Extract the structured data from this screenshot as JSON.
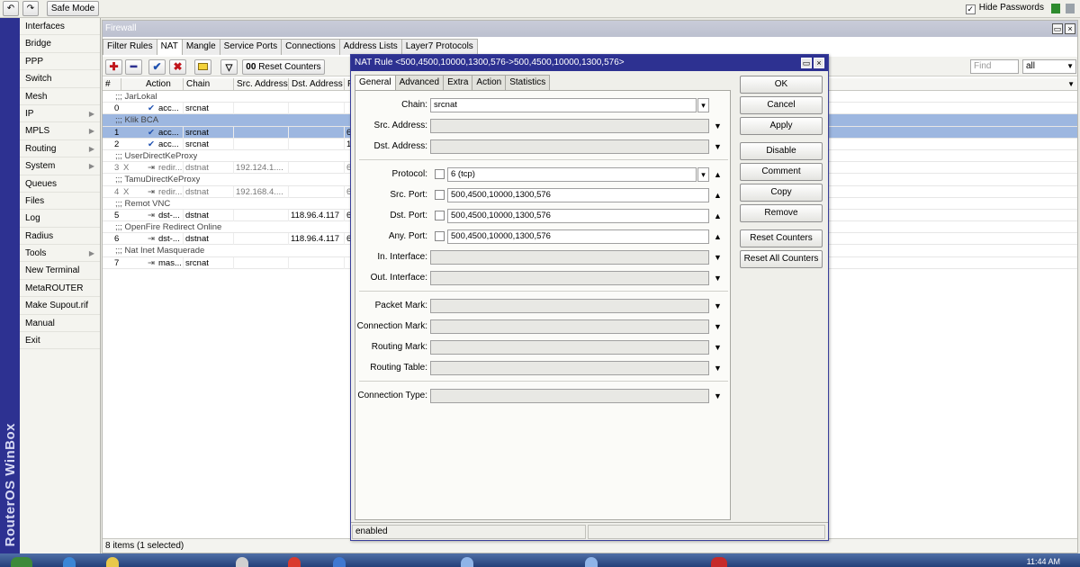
{
  "topbar": {
    "safe_mode_label": "Safe Mode",
    "hide_passwords_label": "Hide Passwords",
    "hide_passwords_checked": true
  },
  "sidebar": {
    "brand": "RouterOS WinBox",
    "items": [
      {
        "label": "Interfaces",
        "submenu": false
      },
      {
        "label": "Bridge",
        "submenu": false
      },
      {
        "label": "PPP",
        "submenu": false
      },
      {
        "label": "Switch",
        "submenu": false
      },
      {
        "label": "Mesh",
        "submenu": false
      },
      {
        "label": "IP",
        "submenu": true
      },
      {
        "label": "MPLS",
        "submenu": true
      },
      {
        "label": "Routing",
        "submenu": true
      },
      {
        "label": "System",
        "submenu": true
      },
      {
        "label": "Queues",
        "submenu": false
      },
      {
        "label": "Files",
        "submenu": false
      },
      {
        "label": "Log",
        "submenu": false
      },
      {
        "label": "Radius",
        "submenu": false
      },
      {
        "label": "Tools",
        "submenu": true
      },
      {
        "label": "New Terminal",
        "submenu": false
      },
      {
        "label": "MetaROUTER",
        "submenu": false
      },
      {
        "label": "Make Supout.rif",
        "submenu": false
      },
      {
        "label": "Manual",
        "submenu": false
      },
      {
        "label": "Exit",
        "submenu": false
      }
    ]
  },
  "firewall": {
    "title": "Firewall",
    "tabs": [
      "Filter Rules",
      "NAT",
      "Mangle",
      "Service Ports",
      "Connections",
      "Address Lists",
      "Layer7 Protocols"
    ],
    "active_tab": "NAT",
    "reset_counters_label": "Reset Counters",
    "find_placeholder": "Find",
    "filter_value": "all",
    "columns": [
      "#",
      "Action",
      "Chain",
      "Src. Address",
      "Dst. Address",
      "F"
    ],
    "rows": [
      {
        "kind": "comment",
        "text": ";;; JarLokal"
      },
      {
        "kind": "rule",
        "num": "0",
        "flag": "",
        "action": "acc...",
        "chain": "srcnat",
        "src": "",
        "dst": "",
        "extra": "",
        "selected": false
      },
      {
        "kind": "comment",
        "text": ";;; Klik BCA",
        "selected": true
      },
      {
        "kind": "rule",
        "num": "1",
        "flag": "",
        "action": "acc...",
        "chain": "srcnat",
        "src": "",
        "dst": "",
        "extra": "6",
        "selected": true
      },
      {
        "kind": "rule",
        "num": "2",
        "flag": "",
        "action": "acc...",
        "chain": "srcnat",
        "src": "",
        "dst": "",
        "extra": "1",
        "selected": false
      },
      {
        "kind": "comment",
        "text": ";;; UserDirectKeProxy"
      },
      {
        "kind": "rule",
        "num": "3",
        "flag": "X",
        "action": "redir...",
        "chain": "dstnat",
        "src": "192.124.1....",
        "dst": "",
        "extra": "6",
        "selected": false
      },
      {
        "kind": "comment",
        "text": ";;; TamuDirectKeProxy"
      },
      {
        "kind": "rule",
        "num": "4",
        "flag": "X",
        "action": "redir...",
        "chain": "dstnat",
        "src": "192.168.4....",
        "dst": "",
        "extra": "6",
        "selected": false
      },
      {
        "kind": "comment",
        "text": ";;; Remot VNC"
      },
      {
        "kind": "rule",
        "num": "5",
        "flag": "",
        "action": "dst-...",
        "chain": "dstnat",
        "src": "",
        "dst": "118.96.4.117",
        "extra": "6",
        "selected": false
      },
      {
        "kind": "comment",
        "text": ";;; OpenFire Redirect Online"
      },
      {
        "kind": "rule",
        "num": "6",
        "flag": "",
        "action": "dst-...",
        "chain": "dstnat",
        "src": "",
        "dst": "118.96.4.117",
        "extra": "6",
        "selected": false
      },
      {
        "kind": "comment",
        "text": ";;; Nat Inet Masquerade"
      },
      {
        "kind": "rule",
        "num": "7",
        "flag": "",
        "action": "mas...",
        "chain": "srcnat",
        "src": "",
        "dst": "",
        "extra": "",
        "selected": false
      }
    ],
    "status": "8 items (1 selected)"
  },
  "dialog": {
    "title": "NAT Rule <500,4500,10000,1300,576->500,4500,10000,1300,576>",
    "tabs": [
      "General",
      "Advanced",
      "Extra",
      "Action",
      "Statistics"
    ],
    "active_tab": "General",
    "fields": {
      "chain": {
        "label": "Chain:",
        "value": "srcnat"
      },
      "src_address": {
        "label": "Src. Address:",
        "value": ""
      },
      "dst_address": {
        "label": "Dst. Address:",
        "value": ""
      },
      "protocol": {
        "label": "Protocol:",
        "value": "6 (tcp)"
      },
      "src_port": {
        "label": "Src. Port:",
        "value": "500,4500,10000,1300,576"
      },
      "dst_port": {
        "label": "Dst. Port:",
        "value": "500,4500,10000,1300,576"
      },
      "any_port": {
        "label": "Any. Port:",
        "value": "500,4500,10000,1300,576"
      },
      "in_interface": {
        "label": "In. Interface:",
        "value": ""
      },
      "out_interface": {
        "label": "Out. Interface:",
        "value": ""
      },
      "packet_mark": {
        "label": "Packet Mark:",
        "value": ""
      },
      "connection_mark": {
        "label": "Connection Mark:",
        "value": ""
      },
      "routing_mark": {
        "label": "Routing Mark:",
        "value": ""
      },
      "routing_table": {
        "label": "Routing Table:",
        "value": ""
      },
      "connection_type": {
        "label": "Connection Type:",
        "value": ""
      }
    },
    "buttons": [
      "OK",
      "Cancel",
      "Apply",
      "Disable",
      "Comment",
      "Copy",
      "Remove",
      "Reset Counters",
      "Reset All Counters"
    ],
    "status": "enabled"
  },
  "taskbar": {
    "clock": "11:44 AM"
  },
  "colors": {
    "accent": "#2d3191",
    "selection": "#9db7e0"
  }
}
